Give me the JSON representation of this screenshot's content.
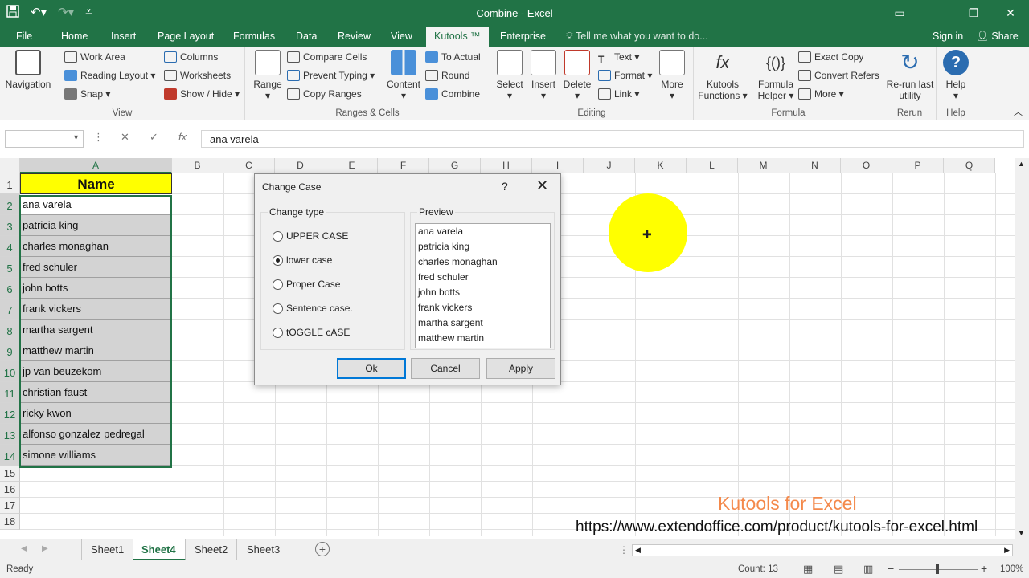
{
  "window": {
    "title": "Combine - Excel"
  },
  "ribbon_tabs": [
    "File",
    "Home",
    "Insert",
    "Page Layout",
    "Formulas",
    "Data",
    "Review",
    "View",
    "Kutools ™",
    "Enterprise"
  ],
  "tell_me": "Tell me what you want to do...",
  "account": {
    "signin": "Sign in",
    "share": "Share"
  },
  "ribbon": {
    "view": {
      "label": "View",
      "navigation": "Navigation",
      "work_area": "Work Area",
      "reading_layout": "Reading Layout",
      "snap": "Snap",
      "columns": "Columns",
      "worksheets": "Worksheets",
      "show_hide": "Show / Hide"
    },
    "ranges": {
      "label": "Ranges & Cells",
      "range": "Range",
      "compare_cells": "Compare Cells",
      "prevent_typing": "Prevent Typing",
      "copy_ranges": "Copy Ranges",
      "content": "Content",
      "to_actual": "To Actual",
      "round": "Round",
      "combine": "Combine"
    },
    "editing": {
      "label": "Editing",
      "select": "Select",
      "insert": "Insert",
      "delete": "Delete",
      "text": "Text",
      "format": "Format",
      "link": "Link",
      "more": "More"
    },
    "formula": {
      "label": "Formula",
      "kutools_functions": "Kutools Functions",
      "formula_helper": "Formula Helper",
      "exact_copy": "Exact Copy",
      "convert_refers": "Convert Refers",
      "more": "More"
    },
    "rerun": {
      "label": "Rerun",
      "rerun_utility": "Re-run last utility"
    },
    "help": {
      "label": "Help",
      "help": "Help"
    }
  },
  "formula_bar": {
    "fx": "fx",
    "value": "ana varela"
  },
  "columns": [
    "A",
    "B",
    "C",
    "D",
    "E",
    "F",
    "G",
    "H",
    "I",
    "J",
    "K",
    "L",
    "M",
    "N",
    "O",
    "P",
    "Q"
  ],
  "rows": [
    "1",
    "2",
    "3",
    "4",
    "5",
    "6",
    "7",
    "8",
    "9",
    "10",
    "11",
    "12",
    "13",
    "14",
    "15",
    "16",
    "17",
    "18"
  ],
  "cells_a": [
    "Name",
    "ana varela",
    "patricia king",
    "charles monaghan",
    "fred schuler",
    "john botts",
    "frank vickers",
    "martha sargent",
    "matthew martin",
    "jp van beuzekom",
    "christian faust",
    "ricky kwon",
    "alfonso gonzalez pedregal",
    "simone williams"
  ],
  "dialog": {
    "title": "Change Case",
    "help": "?",
    "change_type_label": "Change type",
    "options": [
      "UPPER CASE",
      "lower case",
      "Proper Case",
      "Sentence case.",
      "tOGGLE cASE"
    ],
    "selected_option": "lower case",
    "preview_label": "Preview",
    "preview": [
      "ana varela",
      "patricia king",
      "charles monaghan",
      "fred schuler",
      "john botts",
      "frank vickers",
      "martha sargent",
      "matthew martin"
    ],
    "ok": "Ok",
    "cancel": "Cancel",
    "apply": "Apply"
  },
  "watermark": {
    "brand": "Kutools for Excel",
    "url": "https://www.extendoffice.com/product/kutools-for-excel.html"
  },
  "sheets": [
    "Sheet1",
    "Sheet4",
    "Sheet2",
    "Sheet3"
  ],
  "active_sheet": "Sheet4",
  "status": {
    "ready": "Ready",
    "count": "Count: 13",
    "zoom": "100%"
  },
  "colors": {
    "excel_green": "#217346",
    "highlight": "#ffff00",
    "watermark": "#f4894b"
  }
}
